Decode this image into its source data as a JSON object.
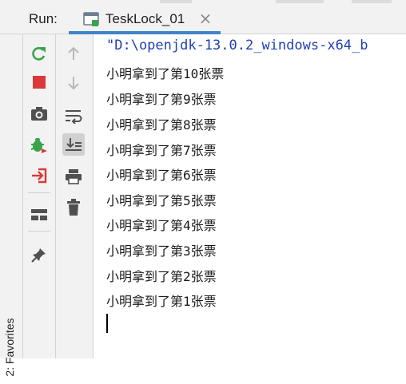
{
  "run_bar": {
    "label": "Run:",
    "tab": {
      "title": "TeskLock_01",
      "close_glyph": "×",
      "icon": "application-run-icon"
    },
    "accent_color": "#4083c9"
  },
  "side_strip": {
    "favorites_label": "2: Favorites"
  },
  "toolbar_left": {
    "buttons": [
      {
        "name": "rerun-icon",
        "color": "#3aa34a"
      },
      {
        "name": "stop-icon",
        "color": "#d9393a"
      },
      {
        "name": "camera-icon",
        "color": "#505050"
      },
      {
        "name": "debug-icon",
        "color": "#3aa34a"
      },
      {
        "name": "exit-icon",
        "color": "#d9393a"
      },
      {
        "name": "layout-icon",
        "color": "#505050"
      },
      {
        "name": "pin-icon",
        "color": "#505050"
      }
    ]
  },
  "toolbar_right": {
    "buttons": [
      {
        "name": "arrow-up-icon",
        "state": "disabled"
      },
      {
        "name": "arrow-down-icon",
        "state": "disabled"
      },
      {
        "name": "soft-wrap-icon",
        "state": "normal"
      },
      {
        "name": "scroll-to-end-icon",
        "state": "active"
      },
      {
        "name": "print-icon",
        "state": "normal"
      },
      {
        "name": "trash-icon",
        "state": "normal"
      }
    ]
  },
  "console": {
    "command_line": "\"D:\\openjdk-13.0.2_windows-x64_b",
    "output_lines": [
      "小明拿到了第10张票",
      "小明拿到了第9张票",
      "小明拿到了第8张票",
      "小明拿到了第7张票",
      "小明拿到了第6张票",
      "小明拿到了第5张票",
      "小明拿到了第4张票",
      "小明拿到了第3张票",
      "小明拿到了第2张票",
      "小明拿到了第1张票"
    ]
  }
}
